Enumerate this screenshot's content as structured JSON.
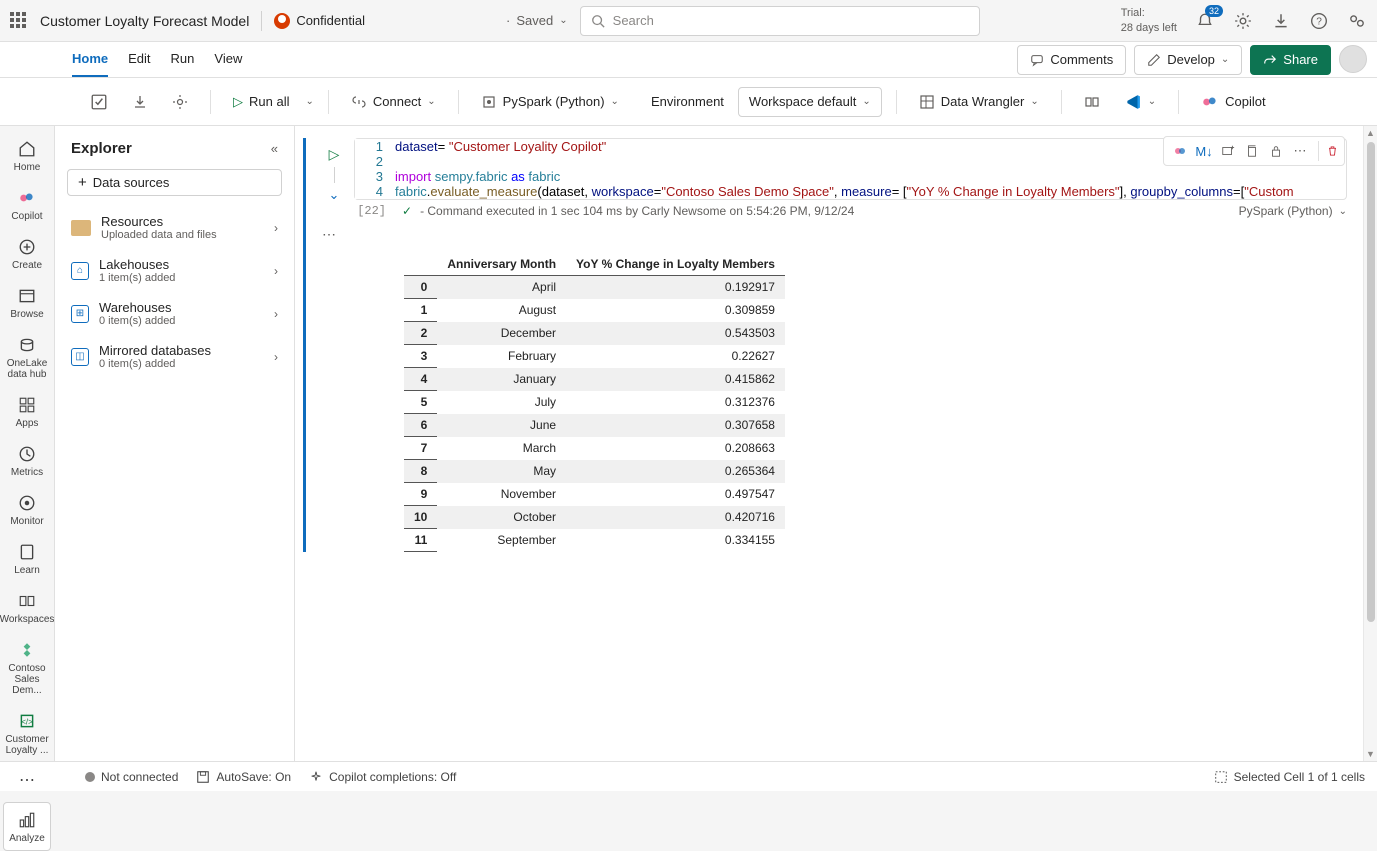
{
  "header": {
    "title": "Customer Loyalty Forecast Model",
    "confidentialLabel": "Confidential",
    "savedStatus": "Saved",
    "searchPlaceholder": "Search",
    "trialLine1": "Trial:",
    "trialLine2": "28 days left",
    "notificationCount": "32"
  },
  "tabs": {
    "items": [
      "Home",
      "Edit",
      "Run",
      "View"
    ],
    "commentsBtn": "Comments",
    "developBtn": "Develop",
    "shareBtn": "Share"
  },
  "toolbar": {
    "runAll": "Run all",
    "connect": "Connect",
    "kernel": "PySpark (Python)",
    "environment": "Environment",
    "workspaceDefault": "Workspace default",
    "dataWrangler": "Data Wrangler",
    "copilot": "Copilot"
  },
  "rail": {
    "home": "Home",
    "copilot": "Copilot",
    "create": "Create",
    "browse": "Browse",
    "onelake": "OneLake data hub",
    "apps": "Apps",
    "metrics": "Metrics",
    "monitor": "Monitor",
    "learn": "Learn",
    "workspaces": "Workspaces",
    "contoso": "Contoso Sales Dem...",
    "customer": "Customer Loyalty ...",
    "analyze": "Analyze"
  },
  "explorer": {
    "title": "Explorer",
    "dataSources": "Data sources",
    "resources": {
      "title": "Resources",
      "sub": "Uploaded data and files"
    },
    "lakehouses": {
      "title": "Lakehouses",
      "sub": "1 item(s) added"
    },
    "warehouses": {
      "title": "Warehouses",
      "sub": "0 item(s) added"
    },
    "mirrored": {
      "title": "Mirrored databases",
      "sub": "0 item(s) added"
    }
  },
  "code": {
    "l1": {
      "a": "dataset",
      "b": "= ",
      "c": "\"Customer Loyality Copilot\""
    },
    "l3": {
      "a": "import",
      "b": " sempy.fabric ",
      "c": "as",
      "d": " fabric"
    },
    "l4": {
      "a": "fabric",
      "b": ".",
      "c": "evaluate_measure",
      "d": "(dataset, ",
      "e": "workspace",
      "f": "=",
      "g": "\"Contoso Sales Demo Space\"",
      "h": ", ",
      "i": "measure",
      "j": "= [",
      "k": "\"YoY % Change in Loyalty Members\"",
      "l": "], ",
      "m": "groupby_columns",
      "n": "=[",
      "o": "\"Custom"
    }
  },
  "execution": {
    "index": "[22]",
    "text": "- Command executed in 1 sec 104 ms by Carly Newsome on 5:54:26 PM, 9/12/24",
    "lang": "PySpark (Python)"
  },
  "output": {
    "cols": [
      "Anniversary Month",
      "YoY % Change in Loyalty Members"
    ],
    "rows": [
      {
        "idx": "0",
        "m": "April",
        "v": "0.192917"
      },
      {
        "idx": "1",
        "m": "August",
        "v": "0.309859"
      },
      {
        "idx": "2",
        "m": "December",
        "v": "0.543503"
      },
      {
        "idx": "3",
        "m": "February",
        "v": "0.22627"
      },
      {
        "idx": "4",
        "m": "January",
        "v": "0.415862"
      },
      {
        "idx": "5",
        "m": "July",
        "v": "0.312376"
      },
      {
        "idx": "6",
        "m": "June",
        "v": "0.307658"
      },
      {
        "idx": "7",
        "m": "March",
        "v": "0.208663"
      },
      {
        "idx": "8",
        "m": "May",
        "v": "0.265364"
      },
      {
        "idx": "9",
        "m": "November",
        "v": "0.497547"
      },
      {
        "idx": "10",
        "m": "October",
        "v": "0.420716"
      },
      {
        "idx": "11",
        "m": "September",
        "v": "0.334155"
      }
    ]
  },
  "status": {
    "connection": "Not connected",
    "autosave": "AutoSave: On",
    "copilot": "Copilot completions: Off",
    "selection": "Selected Cell 1 of 1 cells"
  }
}
